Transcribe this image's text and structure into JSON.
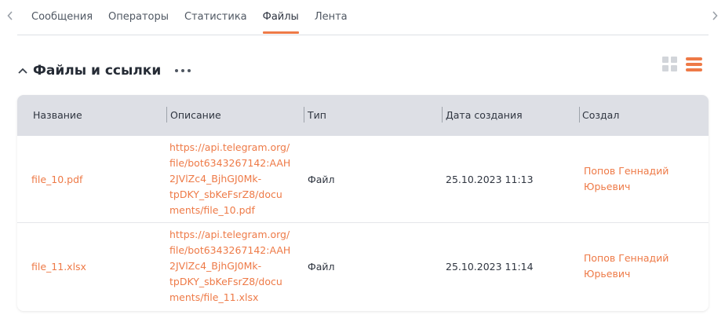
{
  "tabs": [
    {
      "label": "Сообщения",
      "active": false
    },
    {
      "label": "Операторы",
      "active": false
    },
    {
      "label": "Статистика",
      "active": false
    },
    {
      "label": "Файлы",
      "active": true
    },
    {
      "label": "Лента",
      "active": false
    }
  ],
  "section": {
    "title": "Файлы и ссылки"
  },
  "table": {
    "headers": [
      "Название",
      "Описание",
      "Тип",
      "Дата создания",
      "Создал"
    ],
    "rows": [
      {
        "name": "file_10.pdf",
        "description": [
          "https://api.telegram.org/",
          "file/bot6343267142:AAH",
          "2JVlZc4_BjhGJ0Mk-",
          "tpDKY_sbKeFsrZ8/docu",
          "ments/file_10.pdf"
        ],
        "type": "Файл",
        "created": "25.10.2023 11:13",
        "author": [
          "Попов Геннадий",
          "Юрьевич"
        ]
      },
      {
        "name": "file_11.xlsx",
        "description": [
          "https://api.telegram.org/",
          "file/bot6343267142:AAH",
          "2JVlZc4_BjhGJ0Mk-",
          "tpDKY_sbKeFsrZ8/docu",
          "ments/file_11.xlsx"
        ],
        "type": "Файл",
        "created": "25.10.2023 11:14",
        "author": [
          "Попов Геннадий",
          "Юрьевич"
        ]
      }
    ]
  },
  "colors": {
    "accent": "#ee7a47",
    "header_bg": "#dddfe5",
    "text": "#2f3540"
  },
  "icons": {
    "tab_prev": "chevron-left-icon",
    "tab_next": "chevron-right-icon",
    "collapse": "chevron-up-icon",
    "more": "more-horizontal-icon",
    "grid_view": "grid-view-icon",
    "list_view": "list-view-icon"
  }
}
